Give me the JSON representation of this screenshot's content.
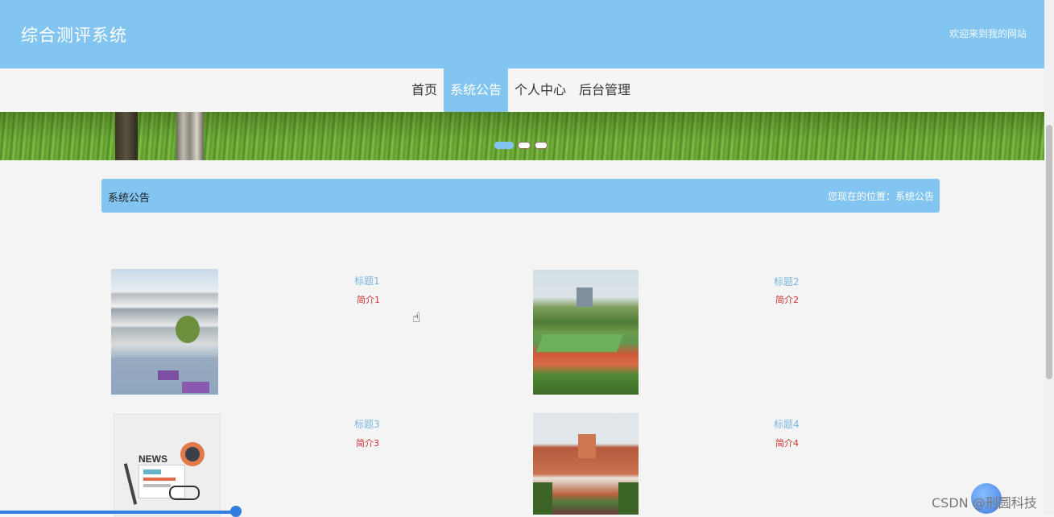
{
  "header": {
    "site_title": "综合测评系统",
    "welcome": "欢迎来到我的网站"
  },
  "nav": {
    "items": [
      "首页",
      "系统公告",
      "个人中心",
      "后台管理"
    ],
    "active": "系统公告"
  },
  "carousel": {
    "slide_count": 3,
    "active_index": 0
  },
  "section": {
    "title": "系统公告",
    "breadcrumb": "您现在的位置：系统公告"
  },
  "notices": [
    {
      "title": "标题1",
      "desc": "简介1",
      "image": "campus-courtyard"
    },
    {
      "title": "标题2",
      "desc": "简介2",
      "image": "running-track"
    },
    {
      "title": "标题3",
      "desc": "简介3",
      "image": "news-illustration"
    },
    {
      "title": "标题4",
      "desc": "简介4",
      "image": "school-building"
    }
  ],
  "news_image_text": "NEWS",
  "watermark": "CSDN @刑圆科技",
  "icons": {
    "cursor": "hand-pointer-icon"
  },
  "colors": {
    "accent": "#82c5f1",
    "desc_red": "#d03030",
    "title_blue": "#7ab6e0"
  }
}
